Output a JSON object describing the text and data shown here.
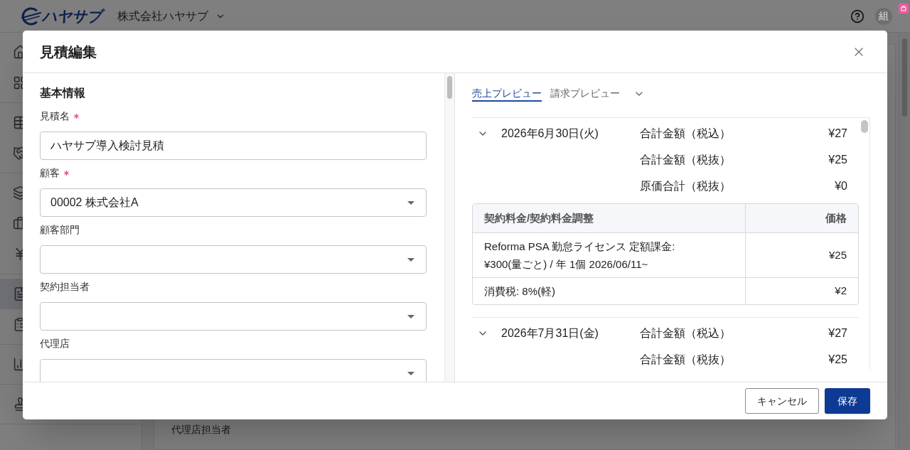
{
  "app_header": {
    "logo_text": "ハヤサブ",
    "company": "株式会社ハヤサブ",
    "avatar_initial": "組"
  },
  "sidebar": {
    "groups": [
      {
        "items": [
          {
            "selected": false
          },
          {
            "selected": false
          }
        ]
      },
      {
        "items": [
          {
            "selected": false
          },
          {
            "selected": false
          }
        ]
      },
      {
        "items": [
          {
            "selected": false
          },
          {
            "selected": false
          },
          {
            "selected": false
          }
        ]
      },
      {
        "items": [
          {
            "selected": true
          },
          {
            "selected": false
          }
        ]
      },
      {
        "items": [
          {
            "selected": false
          }
        ]
      },
      {
        "items": [
          {
            "selected": false
          }
        ]
      }
    ]
  },
  "page": {
    "field_labels": [
      "代理店担当者"
    ]
  },
  "dialog": {
    "title": "見積編集",
    "form": {
      "section_title": "基本情報",
      "fields": [
        {
          "kind": "text",
          "label": "見積名",
          "required": true,
          "value": "ハヤサブ導入検討見積"
        },
        {
          "kind": "select",
          "label": "顧客",
          "required": true,
          "value": "00002 株式会社A"
        },
        {
          "kind": "select",
          "label": "顧客部門",
          "required": false
        },
        {
          "kind": "select",
          "label": "契約担当者",
          "required": false
        },
        {
          "kind": "select",
          "label": "代理店",
          "required": false
        }
      ]
    },
    "preview": {
      "tabs": [
        {
          "label": "売上プレビュー",
          "selected": true
        },
        {
          "label": "請求プレビュー",
          "selected": false
        }
      ],
      "groups": [
        {
          "date": "2026年6月30日(火)",
          "totals": [
            {
              "label": "合計金額（税込）",
              "value": "¥27"
            },
            {
              "label": "合計金額（税抜）",
              "value": "¥25"
            },
            {
              "label": "原価合計（税抜）",
              "value": "¥0"
            }
          ],
          "table": {
            "columns": [
              "契約料金/契約料金調整",
              "価格"
            ],
            "rows": [
              [
                "Reforma PSA 勤怠ライセンス 定額課金: ¥300(量ごと) / 年 1個 2026/06/11~",
                "¥25"
              ],
              [
                "消費税: 8%(軽)",
                "¥2"
              ]
            ]
          }
        },
        {
          "date": "2026年7月31日(金)",
          "totals": [
            {
              "label": "合計金額（税込）",
              "value": "¥27"
            },
            {
              "label": "合計金額（税抜）",
              "value": "¥25"
            }
          ]
        }
      ]
    },
    "buttons": [
      {
        "kind": "cancel",
        "label": "キャンセル"
      },
      {
        "kind": "save",
        "label": "保存"
      }
    ]
  }
}
